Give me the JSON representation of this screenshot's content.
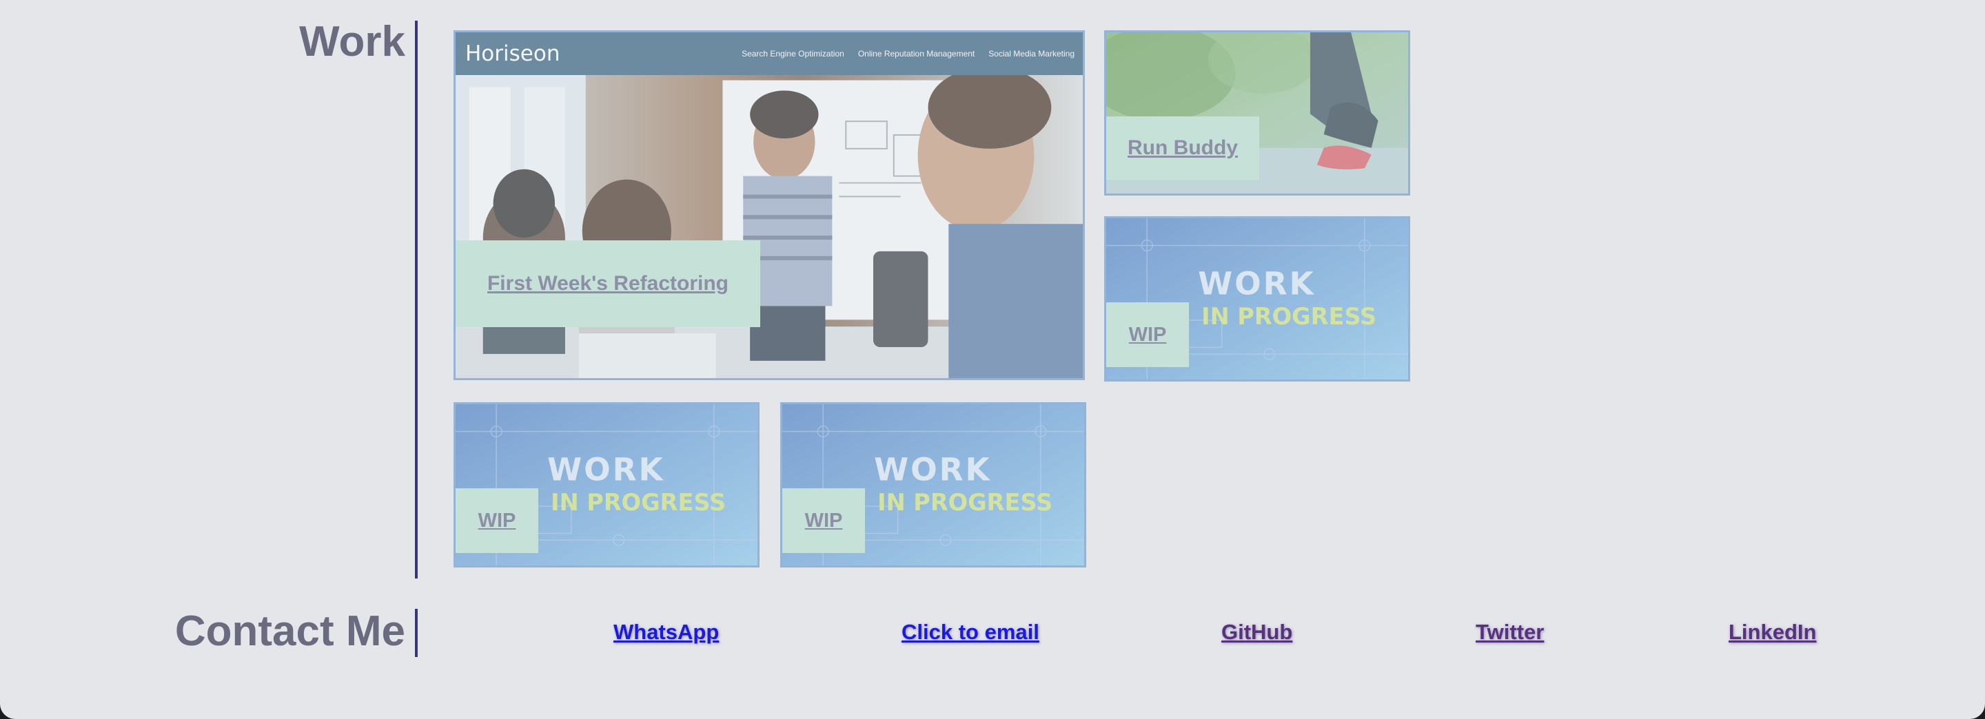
{
  "work": {
    "title": "Work",
    "projects": [
      {
        "label": "First Week's Refactoring",
        "preview": "horiseon-site-screenshot"
      },
      {
        "label": "Run Buddy",
        "preview": "runner-tying-shoe-photo"
      },
      {
        "label": "WIP",
        "preview": "work-in-progress-blueprint"
      },
      {
        "label": "WIP",
        "preview": "work-in-progress-blueprint"
      },
      {
        "label": "WIP",
        "preview": "work-in-progress-blueprint"
      }
    ],
    "horiseon": {
      "brand": "Horiseon",
      "nav": [
        "Search Engine Optimization",
        "Online Reputation Management",
        "Social Media Marketing"
      ]
    },
    "wip_art": {
      "line1": "WORK",
      "line2": "IN PROGRESS"
    }
  },
  "contact": {
    "title": "Contact Me",
    "links": [
      {
        "label": "WhatsApp",
        "visited": false
      },
      {
        "label": "Click to email",
        "visited": false
      },
      {
        "label": "GitHub",
        "visited": true
      },
      {
        "label": "Twitter",
        "visited": true
      },
      {
        "label": "LinkedIn",
        "visited": true
      }
    ]
  },
  "colors": {
    "background": "#e5e6ea",
    "heading": "#6b6b80",
    "divider": "#35357a",
    "label_bg": "#c5e1d8",
    "link_unvisited": "#1a1adb",
    "link_visited": "#56327d"
  }
}
